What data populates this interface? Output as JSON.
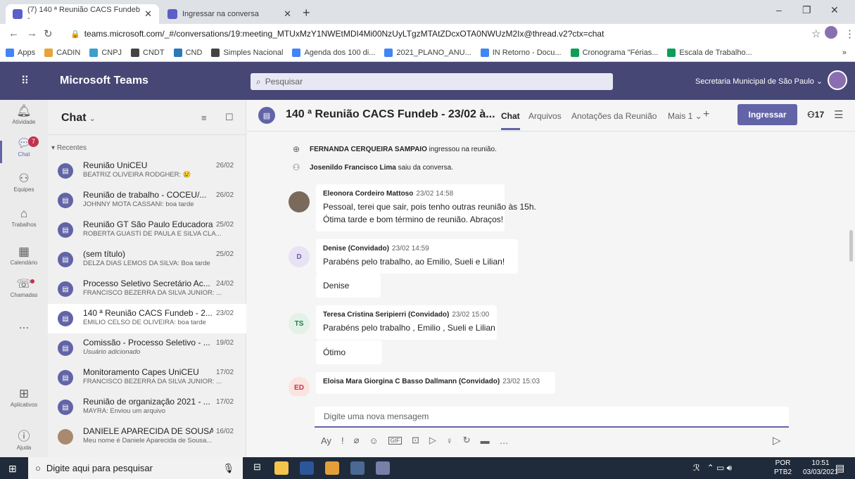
{
  "browser": {
    "tabs": [
      {
        "title": "(7) 140 ª Reunião CACS Fundeb - ",
        "close": "✕"
      },
      {
        "title": "Ingressar na conversa",
        "close": "✕"
      }
    ],
    "new_tab": "+",
    "url": "teams.microsoft.com/_#/conversations/19:meeting_MTUxMzY1NWEtMDI4Mi00NzUyLTgzMTAtZDcxOTA0NWUzM2Ix@thread.v2?ctx=chat",
    "bookmarks": [
      {
        "label": "Apps",
        "color": "#4285f4"
      },
      {
        "label": "CADIN",
        "color": "#e8a33a"
      },
      {
        "label": "CNPJ",
        "color": "#3aa0c8"
      },
      {
        "label": "CNDT",
        "color": "#444444"
      },
      {
        "label": "CND",
        "color": "#2a7ab8"
      },
      {
        "label": "Simples Nacional",
        "color": "#444444"
      },
      {
        "label": "Agenda dos 100 di...",
        "color": "#4285f4"
      },
      {
        "label": "2021_PLANO_ANU...",
        "color": "#4285f4"
      },
      {
        "label": "IN Retorno - Docu...",
        "color": "#4285f4"
      },
      {
        "label": "Cronograma \"Férias...",
        "color": "#0f9d58"
      },
      {
        "label": "Escala de Trabalho...",
        "color": "#0f9d58"
      }
    ],
    "more": "»"
  },
  "teams": {
    "app_title": "Microsoft Teams",
    "search_placeholder": "Pesquisar",
    "org": "Secretaria Municipal de São Paulo",
    "rail": [
      {
        "label": "Atividade",
        "icon": "bell-icon"
      },
      {
        "label": "Chat",
        "icon": "chat-icon",
        "badge": "7"
      },
      {
        "label": "Equipes",
        "icon": "teams-icon"
      },
      {
        "label": "Trabalhos",
        "icon": "assignments-icon"
      },
      {
        "label": "Calendário",
        "icon": "calendar-icon"
      },
      {
        "label": "Chamadas",
        "icon": "calls-icon"
      },
      {
        "label": "...",
        "icon": "more-icon"
      },
      {
        "label": "Aplicativos",
        "icon": "apps-icon"
      },
      {
        "label": "Ajuda",
        "icon": "help-icon"
      }
    ]
  },
  "chatlist": {
    "title": "Chat",
    "section": "Recentes",
    "items": [
      {
        "title": "Reunião UniCEU",
        "date": "26/02",
        "preview": "BEATRIZ OLIVEIRA RODGHER: 😢"
      },
      {
        "title": "Reunião de trabalho - COCEU/...",
        "date": "26/02",
        "preview": "JOHNNY MOTA CASSANI: boa tarde"
      },
      {
        "title": "Reunião GT São Paulo Educadora",
        "date": "25/02",
        "preview": "ROBERTA GUASTI DE PAULA E SILVA CLA..."
      },
      {
        "title": "(sem título)",
        "date": "25/02",
        "preview": "DELZA DIAS LEMOS DA SILVA: Boa tarde"
      },
      {
        "title": "Processo Seletivo Secretário Ac...",
        "date": "24/02",
        "preview": "FRANCISCO BEZERRA DA SILVA JUNIOR: ..."
      },
      {
        "title": "140 ª Reunião CACS Fundeb - 2...",
        "date": "23/02",
        "preview": "EMILIO CELSO DE OLIVEIRA: boa tarde"
      },
      {
        "title": "Comissão - Processo Seletivo - ...",
        "date": "19/02",
        "preview": "Usuário adicionado"
      },
      {
        "title": "Monitoramento Capes UniCEU",
        "date": "17/02",
        "preview": "FRANCISCO BEZERRA DA SILVA JUNIOR: ..."
      },
      {
        "title": "Reunião de organização 2021 - ...",
        "date": "17/02",
        "preview": "MAYRA: Enviou um arquivo"
      },
      {
        "title": "DANIELE APARECIDA DE SOUSA",
        "date": "16/02",
        "preview": "Meu nome é Daniele Aparecida de Sousa..."
      }
    ]
  },
  "chat": {
    "title": "140 ª Reunião CACS Fundeb - 23/02 à...",
    "tabs": [
      "Chat",
      "Arquivos",
      "Anotações da Reunião",
      "Mais 1"
    ],
    "add_tab": "+",
    "join_label": "Ingressar",
    "participants": "17",
    "system_messages": [
      {
        "name": "FERNANDA CERQUEIRA SAMPAIO",
        "text": "ingressou na reunião."
      },
      {
        "name": "Josenildo Francisco Lima",
        "text": "saiu da conversa."
      }
    ],
    "messages": [
      {
        "author": "Eleonora Cordeiro Mattoso",
        "time": "23/02 14:58",
        "lines": [
          "Pessoal, terei que sair, pois tenho outras reunião às 15h.",
          "Ótima tarde e bom término de reunião. Abraços!"
        ]
      },
      {
        "author": "Denise (Convidado)",
        "time": "23/02 14:59",
        "initials": "D",
        "lines": [
          "Parabéns pelo trabalho, ao Emilio, Sueli e Lilian!"
        ],
        "followup": "Denise"
      },
      {
        "author": "Teresa Cristina Seripierri (Convidado)",
        "time": "23/02 15:00",
        "initials": "TS",
        "lines": [
          "Parabéns pelo trabalho , Emilio , Sueli e Lilian"
        ],
        "followup": "Ótimo"
      },
      {
        "author": "Eloisa Mara Giorgina C Basso Dallmann (Convidado)",
        "time": "23/02 15:03",
        "initials": "ED"
      }
    ],
    "compose_placeholder": "Digite uma nova mensagem"
  },
  "taskbar": {
    "search_placeholder": "Digite aqui para pesquisar",
    "lang_top": "POR",
    "lang_bottom": "PTB2",
    "time": "10:51",
    "date": "03/03/2021"
  }
}
